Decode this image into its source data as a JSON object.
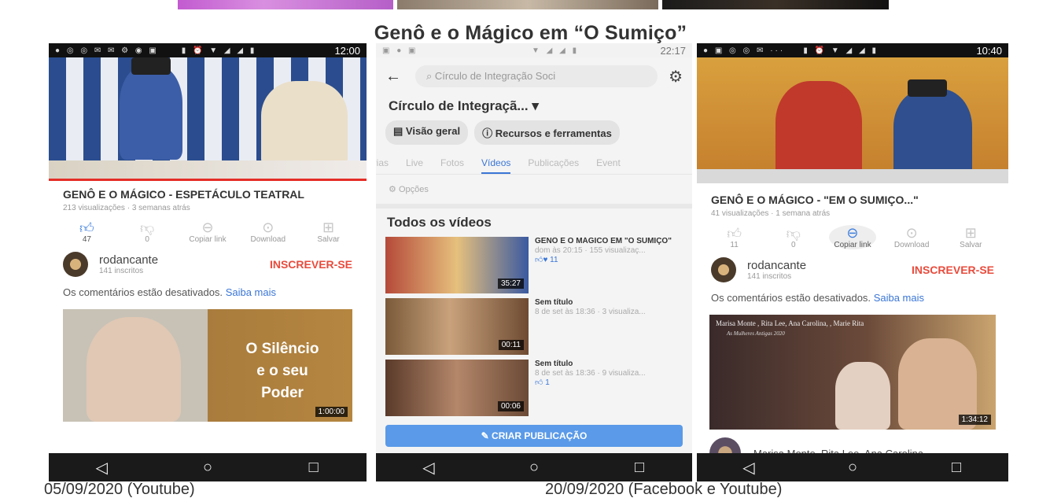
{
  "document": {
    "title": "Genô e o Mágico em “O Sumiço”",
    "caption_left": "05/09/2020   (Youtube)",
    "caption_right": "20/09/2020 (Facebook e Youtube)"
  },
  "nav_icons": [
    "back-triangle-icon",
    "home-circle-icon",
    "overview-square-icon"
  ],
  "phone_youtube_1": {
    "status_time": "12:00",
    "video_title": "GENÔ E O MÁGICO - ESPETÁCULO TEATRAL",
    "video_meta": "213 visualizações · 3 semanas atrás",
    "actions": [
      {
        "icon": "thumbs-up-icon",
        "label": "47",
        "active": true
      },
      {
        "icon": "thumbs-down-icon",
        "label": "0",
        "active": false
      },
      {
        "icon": "link-icon",
        "label": "Copiar link",
        "active": false
      },
      {
        "icon": "download-icon",
        "label": "Download",
        "active": false
      },
      {
        "icon": "save-icon",
        "label": "Salvar",
        "active": false
      }
    ],
    "channel_name": "rodancante",
    "channel_subs": "141 inscritos",
    "subscribe_label": "INSCREVER-SE",
    "comments_text": "Os comentários estão desativados.",
    "comments_link": "Saiba mais",
    "rec_line1": "O Silêncio",
    "rec_line2": "e o seu",
    "rec_line3": "Poder",
    "rec_duration": "1:00:00"
  },
  "phone_facebook": {
    "status_time": "22:17",
    "search_text": "Círculo de Integração Soci",
    "page_name": "Círculo de Integraçã...",
    "chips": [
      "Visão geral",
      "Recursos e ferramentas"
    ],
    "tabs": [
      "irias",
      "Live",
      "Fotos",
      "Vídeos",
      "Publicações",
      "Event"
    ],
    "active_tab": "Vídeos",
    "options_label": "Opções",
    "section_title": "Todos os vídeos",
    "videos": [
      {
        "title": "GENÔ E O MÁGICO EM \"O SUMIÇO\"",
        "meta": "dom às 20:15 · 155 visualizaç...",
        "reactions": "11",
        "duration": "35:27"
      },
      {
        "title": "Sem título",
        "meta": "8 de set às 18:36 · 3 visualiza...",
        "reactions": "",
        "duration": "00:11"
      },
      {
        "title": "Sem título",
        "meta": "8 de set às 18:36 · 9 visualiza...",
        "reactions": "1",
        "duration": "00:06"
      }
    ],
    "create_post_label": "CRIAR PUBLICAÇÃO"
  },
  "phone_youtube_2": {
    "status_time": "10:40",
    "video_title": "GENÔ E O MÁGICO - \"EM O SUMIÇO...\"",
    "video_meta": "41 visualizações · 1 semana atrás",
    "actions": [
      {
        "icon": "thumbs-up-icon",
        "label": "11",
        "active": false
      },
      {
        "icon": "thumbs-down-icon",
        "label": "0",
        "active": false
      },
      {
        "icon": "link-icon",
        "label": "Copiar link",
        "active": true
      },
      {
        "icon": "download-icon",
        "label": "Download",
        "active": false
      },
      {
        "icon": "save-icon",
        "label": "Salvar",
        "active": false
      }
    ],
    "channel_name": "rodancante",
    "channel_subs": "141 inscritos",
    "subscribe_label": "INSCREVER-SE",
    "comments_text": "Os comentários estão desativados.",
    "comments_link": "Saiba mais",
    "rec_title": "Marisa Monte , Rita Lee, Ana Carolina, , Marie Rita",
    "rec_subtitle": "As Mulheres Antigas 2020",
    "rec_duration": "1:34:12",
    "next_title": "Marisa Monte, Rita Lee, Ana Carolina,"
  }
}
